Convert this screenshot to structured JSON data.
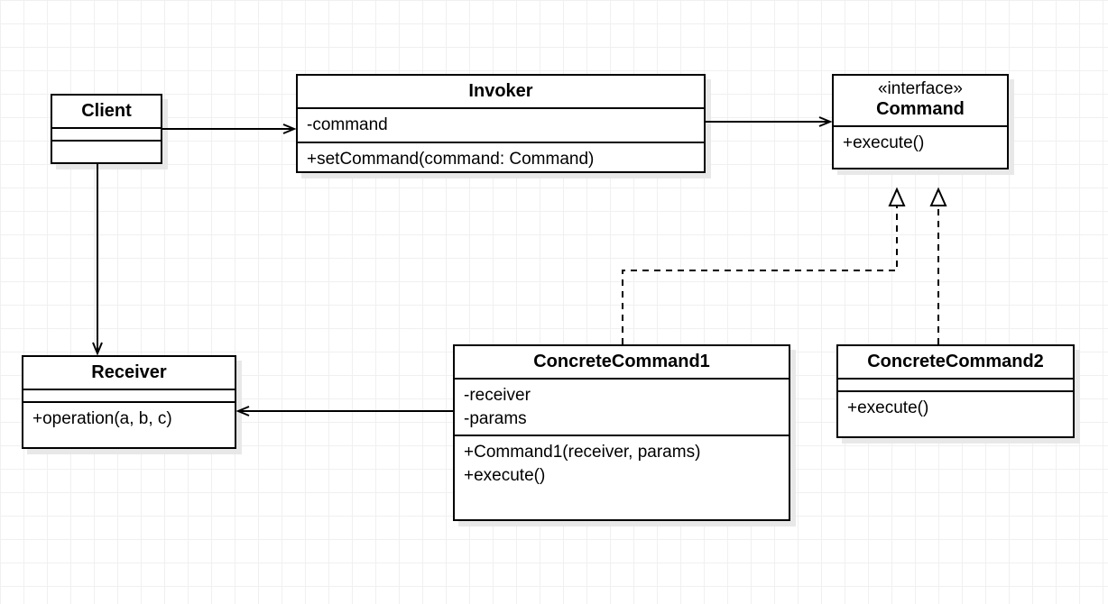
{
  "diagram": {
    "type": "uml-class",
    "pattern": "Command Pattern",
    "classes": {
      "client": {
        "name": "Client",
        "attributes": [],
        "operations": []
      },
      "invoker": {
        "name": "Invoker",
        "attributes": [
          "-command"
        ],
        "operations": [
          "+setCommand(command: Command)"
        ]
      },
      "command": {
        "stereotype": "«interface»",
        "name": "Command",
        "attributes": [],
        "operations": [
          "+execute()"
        ]
      },
      "receiver": {
        "name": "Receiver",
        "attributes": [],
        "operations": [
          "+operation(a, b, c)"
        ]
      },
      "concrete1": {
        "name": "ConcreteCommand1",
        "attributes": [
          "-receiver",
          "-params"
        ],
        "operations": [
          "+Command1(receiver, params)",
          "+execute()"
        ]
      },
      "concrete2": {
        "name": "ConcreteCommand2",
        "attributes": [],
        "operations": [
          "+execute()"
        ]
      }
    },
    "relationships": [
      {
        "from": "client",
        "to": "invoker",
        "type": "association",
        "style": "solid-open-arrow"
      },
      {
        "from": "client",
        "to": "receiver",
        "type": "association",
        "style": "solid-open-arrow"
      },
      {
        "from": "invoker",
        "to": "command",
        "type": "association",
        "style": "solid-open-arrow"
      },
      {
        "from": "concrete1",
        "to": "receiver",
        "type": "association",
        "style": "solid-open-arrow"
      },
      {
        "from": "concrete1",
        "to": "command",
        "type": "realization",
        "style": "dashed-hollow-triangle"
      },
      {
        "from": "concrete2",
        "to": "command",
        "type": "realization",
        "style": "dashed-hollow-triangle"
      }
    ]
  }
}
